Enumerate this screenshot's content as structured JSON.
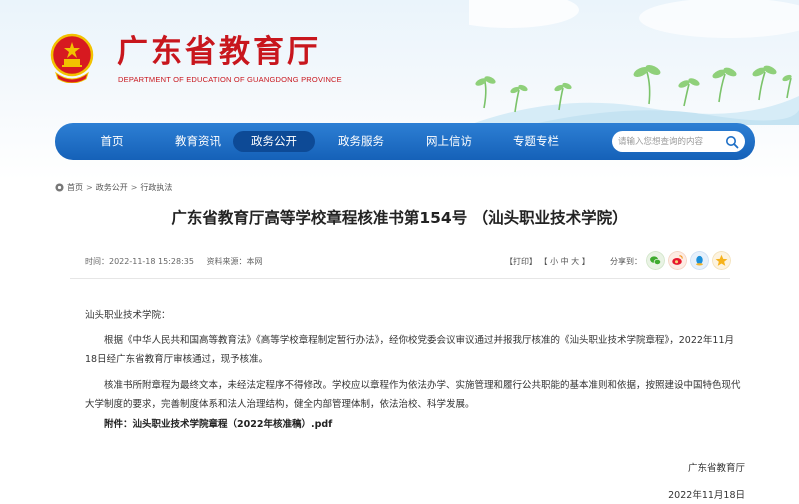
{
  "header": {
    "title": "广东省教育厅",
    "subtitle": "DEPARTMENT OF EDUCATION OF GUANGDONG PROVINCE",
    "brand_color": "#c8161d"
  },
  "nav": {
    "items": [
      {
        "label": "首页"
      },
      {
        "label": "教育资讯"
      },
      {
        "label": "政务公开"
      },
      {
        "label": "政务服务"
      },
      {
        "label": "网上信访"
      },
      {
        "label": "专题专栏"
      }
    ],
    "active_index": 2,
    "search_placeholder": "请输入您想查询的内容",
    "nav_color": "#1e6fc6"
  },
  "breadcrumb": {
    "items": [
      "首页",
      "政务公开",
      "行政执法"
    ],
    "separator": ">"
  },
  "article": {
    "title": "广东省教育厅高等学校章程核准书第154号  （汕头职业技术学院）",
    "time_label": "时间：2022-11-18 15:28:35",
    "source_label": "资料来源：本网",
    "print": "【打印】",
    "font_size_label": "【 小  中  大 】",
    "share_label": "分享到：",
    "share_icons": [
      "wechat-icon",
      "weibo-icon",
      "qq-icon",
      "qzone-icon"
    ],
    "salutation": "汕头职业技术学院：",
    "paragraph1": "根据《中华人民共和国高等教育法》《高等学校章程制定暂行办法》，经你校党委会议审议通过并报我厅核准的《汕头职业技术学院章程》，2022年11月18日经广东省教育厅审核通过，现予核准。",
    "paragraph2": "核准书所附章程为最终文本，未经法定程序不得修改。学校应以章程作为依法办学、实施管理和履行公共职能的基本准则和依据，按照建设中国特色现代大学制度的要求，完善制度体系和法人治理结构，健全内部管理体制，依法治校、科学发展。",
    "attachment_label": "附件：",
    "attachment_name": "汕头职业技术学院章程（2022年核准稿）.pdf",
    "signature": "广东省教育厅",
    "date": "2022年11月18日"
  }
}
